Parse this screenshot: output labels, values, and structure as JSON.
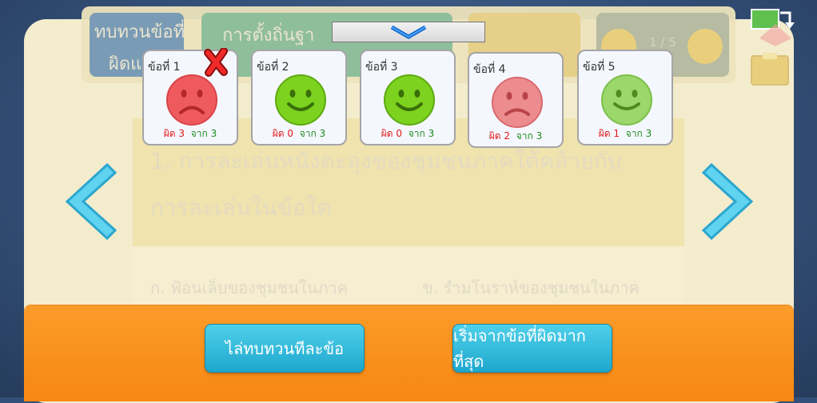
{
  "background": {
    "question_text_line1": "1. การละเล่นหนังตะลุงของชุมชนภาคใต้คล้ายกับ",
    "question_text_line2": "การละเล่นในข้อใด",
    "choice_a": "ก.  ฟ้อนเล็บของชุมชนในภาค",
    "choice_b": "ข.  รำมโนราห์ของชุมชนในภาค",
    "top_left_line1": "ทบทวนข้อที่",
    "top_left_line2": "ผิดแ",
    "top_title": "การตั้งถิ่นฐา",
    "page_indicator": "1 / 5"
  },
  "review_items": [
    {
      "label": "ข้อที่ 1",
      "wrong_prefix": "ผิด",
      "wrong": "3",
      "total_prefix": "จาก",
      "total": "3",
      "state": "sad",
      "selected": true
    },
    {
      "label": "ข้อที่ 2",
      "wrong_prefix": "ผิด",
      "wrong": "0",
      "total_prefix": "จาก",
      "total": "3",
      "state": "happy",
      "selected": false
    },
    {
      "label": "ข้อที่ 3",
      "wrong_prefix": "ผิด",
      "wrong": "0",
      "total_prefix": "จาก",
      "total": "3",
      "state": "happy",
      "selected": false
    },
    {
      "label": "ข้อที่ 4",
      "wrong_prefix": "ผิด",
      "wrong": "2",
      "total_prefix": "จาก",
      "total": "3",
      "state": "sad-light",
      "selected": false
    },
    {
      "label": "ข้อที่ 5",
      "wrong_prefix": "ผิด",
      "wrong": "1",
      "total_prefix": "จาก",
      "total": "3",
      "state": "happy-light",
      "selected": false
    }
  ],
  "buttons": {
    "review_each": "ไล่ทบทวนทีละข้อ",
    "start_most_wrong": "เริ่มจากข้อที่ผิดมากที่สุด"
  },
  "colors": {
    "sad": "#ee5a5e",
    "sad_light": "#ec8c8f",
    "happy": "#7cd21e",
    "happy_light": "#9bd76a",
    "bottom_bar": "#f98f1b",
    "button": "#2ab3d6"
  },
  "icons": {
    "dropdown": "chevron-down-icon",
    "prev": "chevron-left-icon",
    "next": "chevron-right-icon",
    "close_badge": "red-x-icon",
    "top_right_1": "swap-screen-icon",
    "top_right_2": "clipboard-icon"
  }
}
